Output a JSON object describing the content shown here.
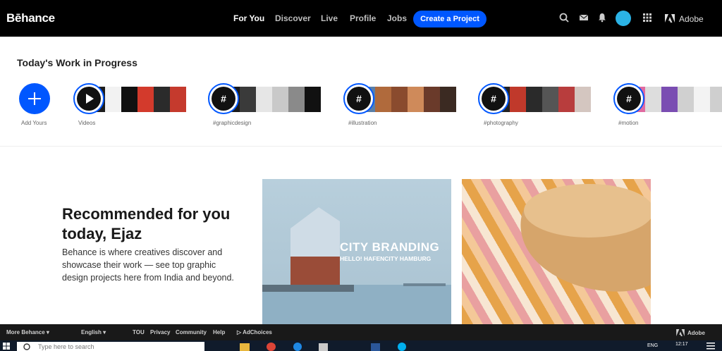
{
  "nav": {
    "logo": "Bēhance",
    "links": [
      "For You",
      "Discover",
      "Live",
      "Profile",
      "Jobs"
    ],
    "create_label": "Create a Project",
    "adobe_label": "Adobe"
  },
  "wip": {
    "title": "Today's Work in Progress",
    "add_label": "Add Yours",
    "stories": [
      {
        "label": "Videos",
        "icon": "play-icon",
        "thumbs": [
          "#1d1d1d",
          "#f2f2f2",
          "#111",
          "#d33a2c",
          "#2b2b2b",
          "#c53a2d"
        ]
      },
      {
        "label": "#graphicdesign",
        "icon": "#",
        "thumbs": [
          "#1a1a1a",
          "#3a3a3a",
          "#e6e6e6",
          "#c9c9c9",
          "#8a8a8a",
          "#111"
        ]
      },
      {
        "label": "#illustration",
        "icon": "#",
        "thumbs": [
          "#5a7fa8",
          "#b06a3c",
          "#8a4b2e",
          "#cf8a5a",
          "#6a3a2a",
          "#3b2a22"
        ]
      },
      {
        "label": "#photography",
        "icon": "#",
        "thumbs": [
          "#222",
          "#c0392b",
          "#2a2a2a",
          "#555",
          "#b83d3d",
          "#d4c6c0"
        ]
      },
      {
        "label": "#motion",
        "icon": "#",
        "thumbs": [
          "#e06aa0",
          "#ddd",
          "#7a4db2",
          "#d0d0d0",
          "#f3f3f3",
          "#cfcfcf"
        ]
      }
    ]
  },
  "recommend": {
    "title": "Recommended for you today, Ejaz",
    "description": "Behance is where creatives discover and showcase their work — see top graphic design projects here from India and beyond."
  },
  "cards": [
    {
      "headline": "CITY BRANDING",
      "subline": "HELLO! HAFENCITY HAMBURG"
    }
  ],
  "footer": {
    "items": [
      "More Behance ▾",
      "English ▾",
      "TOU",
      "Privacy",
      "Community",
      "Help",
      "AdChoices"
    ],
    "adobe_label": "Adobe"
  },
  "taskbar": {
    "search_placeholder": "Type here to search",
    "lang": "ENG",
    "time": "12:17"
  },
  "colors": {
    "accent": "#0057ff",
    "nav_bg": "#000000"
  }
}
